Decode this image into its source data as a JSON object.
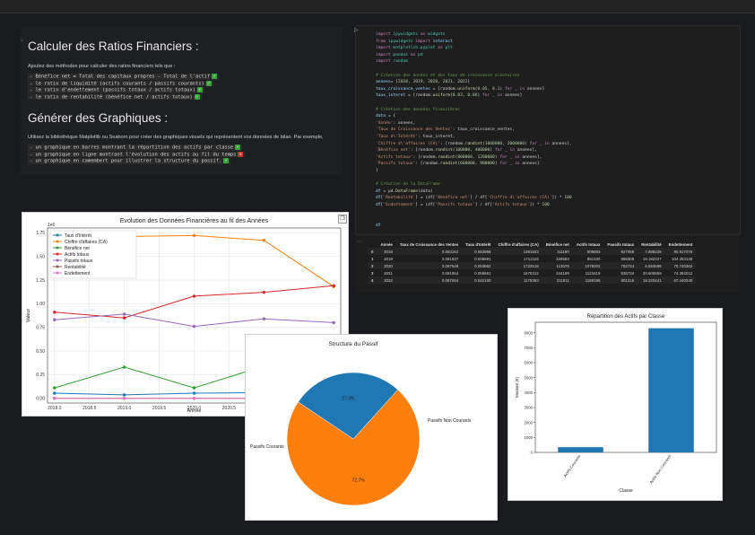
{
  "markdown": {
    "heading1": "Calculer des Ratios Financiers :",
    "intro1": "Ajoutez des méthodes pour calculer des ratios financiers tels que :",
    "ratios": [
      {
        "text": "- Bénéfice net = Total des capitaux propres - Total de l'actif",
        "status": "done"
      },
      {
        "text": "- le ratio de liquidité (actifs courants / passifs courants)",
        "status": "done"
      },
      {
        "text": "- le ratio d'endettement (passifs totaux / actifs totaux)",
        "status": "done"
      },
      {
        "text": "- le ratio de rentabilité (bénéfice net / actifs totaux)",
        "status": "done"
      }
    ],
    "heading2": "Générer des Graphiques :",
    "intro2": "Utilisez la bibliothèque Matplotlib ou Seaborn pour créer des graphiques visuels qui représentent vos données de bilan. Par exemple,",
    "graphs": [
      {
        "text": "- un graphique en barres montrant la répartition des actifs par classe",
        "status": "done"
      },
      {
        "text": "- un graphique en ligne montrant l'évolution des actifs au fil du temps",
        "status": "todo"
      },
      {
        "text": "- un graphique en camembert pour illustrer la structure du passif.",
        "status": "done"
      }
    ]
  },
  "code": {
    "lines": [
      [
        [
          "kw",
          "import "
        ],
        [
          "md",
          "ipywidgets"
        ],
        [
          "kw",
          " as "
        ],
        [
          "md",
          "widgets"
        ]
      ],
      [
        [
          "kw",
          "from "
        ],
        [
          "md",
          "ipywidgets"
        ],
        [
          "kw",
          " import "
        ],
        [
          "vr",
          "interact"
        ]
      ],
      [
        [
          "kw",
          "import "
        ],
        [
          "md",
          "matplotlib.pyplot"
        ],
        [
          "kw",
          " as "
        ],
        [
          "md",
          "plt"
        ]
      ],
      [
        [
          "kw",
          "import "
        ],
        [
          "md",
          "pandas"
        ],
        [
          "kw",
          " as "
        ],
        [
          "md",
          "pd"
        ]
      ],
      [
        [
          "kw",
          "import "
        ],
        [
          "md",
          "random"
        ]
      ],
      [],
      [
        [
          "cm",
          "# Création des années et des taux de croissance aléatoires"
        ]
      ],
      [
        [
          "vr",
          "annees"
        ],
        [
          "",
          "= ["
        ],
        [
          "nm",
          "2018, 2019, 2020, 2021, 2022"
        ],
        [
          "",
          "]"
        ]
      ],
      [
        [
          "vr",
          "taux_croissance_ventes"
        ],
        [
          "",
          " = [random."
        ],
        [
          "fn",
          "uniform"
        ],
        [
          "",
          "("
        ],
        [
          "nm",
          "0.05, 0.1"
        ],
        [
          "",
          ") "
        ],
        [
          "kw",
          "for"
        ],
        [
          "",
          " _ "
        ],
        [
          "kw",
          "in"
        ],
        [
          "",
          " annees]"
        ]
      ],
      [
        [
          "vr",
          "taux_interet"
        ],
        [
          "",
          " = [random."
        ],
        [
          "fn",
          "uniform"
        ],
        [
          "",
          "("
        ],
        [
          "nm",
          "0.03, 0.06"
        ],
        [
          "",
          ") "
        ],
        [
          "kw",
          "for"
        ],
        [
          "",
          " _ "
        ],
        [
          "kw",
          "in"
        ],
        [
          "",
          " annees]"
        ]
      ],
      [],
      [
        [
          "cm",
          "# Création des données financières"
        ]
      ],
      [
        [
          "vr",
          "data"
        ],
        [
          "",
          " = {"
        ]
      ],
      [
        [
          "",
          "    "
        ],
        [
          "st",
          "'Année'"
        ],
        [
          "",
          ": annees,"
        ]
      ],
      [
        [
          "",
          "    "
        ],
        [
          "st",
          "'Taux de Croissance des Ventes'"
        ],
        [
          "",
          ": taux_croissance_ventes,"
        ]
      ],
      [
        [
          "",
          "    "
        ],
        [
          "st",
          "'Taux d\\'Intérêt'"
        ],
        [
          "",
          ": taux_interet,"
        ]
      ],
      [
        [
          "",
          "    "
        ],
        [
          "st",
          "'Chiffre d\\'affaires (CA)'"
        ],
        [
          "",
          ": [random."
        ],
        [
          "fn",
          "randint"
        ],
        [
          "",
          "("
        ],
        [
          "nm",
          "1000000, 2000000"
        ],
        [
          "",
          ") "
        ],
        [
          "kw",
          "for"
        ],
        [
          "",
          " _ "
        ],
        [
          "kw",
          "in"
        ],
        [
          "",
          " annees],"
        ]
      ],
      [
        [
          "",
          "    "
        ],
        [
          "st",
          "'Bénéfice net'"
        ],
        [
          "",
          ": [random."
        ],
        [
          "fn",
          "randint"
        ],
        [
          "",
          "("
        ],
        [
          "nm",
          "100000, 400000"
        ],
        [
          "",
          ") "
        ],
        [
          "kw",
          "for"
        ],
        [
          "",
          " _ "
        ],
        [
          "kw",
          "in"
        ],
        [
          "",
          " annees],"
        ]
      ],
      [
        [
          "",
          "    "
        ],
        [
          "st",
          "'Actifs totaux'"
        ],
        [
          "",
          ": [random."
        ],
        [
          "fn",
          "randint"
        ],
        [
          "",
          "("
        ],
        [
          "nm",
          "800000, 1200000"
        ],
        [
          "",
          ") "
        ],
        [
          "kw",
          "for"
        ],
        [
          "",
          " _ "
        ],
        [
          "kw",
          "in"
        ],
        [
          "",
          " annees],"
        ]
      ],
      [
        [
          "",
          "    "
        ],
        [
          "st",
          "'Passifs totaux'"
        ],
        [
          "",
          ": [random."
        ],
        [
          "fn",
          "randint"
        ],
        [
          "",
          "("
        ],
        [
          "nm",
          "600000, 900000"
        ],
        [
          "",
          ") "
        ],
        [
          "kw",
          "for"
        ],
        [
          "",
          " _ "
        ],
        [
          "kw",
          "in"
        ],
        [
          "",
          " annees]"
        ]
      ],
      [
        [
          "",
          "}"
        ]
      ],
      [],
      [
        [
          "cm",
          "# Création de la DataFrame"
        ]
      ],
      [
        [
          "vr",
          "df"
        ],
        [
          "",
          " = pd."
        ],
        [
          "fn",
          "DataFrame"
        ],
        [
          "",
          "(data)"
        ]
      ],
      [
        [
          "vr",
          "df"
        ],
        [
          "",
          "["
        ],
        [
          "st",
          "'Rentabilité'"
        ],
        [
          "",
          "] = (df["
        ],
        [
          "st",
          "'Bénéfice net'"
        ],
        [
          "",
          "] / df["
        ],
        [
          "st",
          "'Chiffre d\\'affaires (CA)'"
        ],
        [
          "",
          "]) * "
        ],
        [
          "nm",
          "100"
        ]
      ],
      [
        [
          "vr",
          "df"
        ],
        [
          "",
          "["
        ],
        [
          "st",
          "'Endettement'"
        ],
        [
          "",
          "] = (df["
        ],
        [
          "st",
          "'Passifs totaux'"
        ],
        [
          "",
          "] / df["
        ],
        [
          "st",
          "'Actifs totaux'"
        ],
        [
          "",
          "]) * "
        ],
        [
          "nm",
          "100"
        ]
      ],
      [],
      [],
      [
        [
          "vr",
          "df"
        ]
      ]
    ]
  },
  "dataframe": {
    "columns": [
      "",
      "Année",
      "Taux de Croissance des Ventes",
      "Taux d'Intérêt",
      "Chiffre d'affaires (CA)",
      "Bénéfice net",
      "Actifs totaux",
      "Passifs totaux",
      "Rentabilité",
      "Endettement"
    ],
    "rows": [
      [
        "0",
        "2018",
        "0.063152",
        "0.053958",
        "1391923",
        "111190",
        "909683",
        "827059",
        "7.988229",
        "90.917276"
      ],
      [
        "1",
        "2019",
        "0.081937",
        "0.035691",
        "1712115",
        "328683",
        "851230",
        "888306",
        "19.182227",
        "104.353128"
      ],
      [
        "2",
        "2020",
        "0.067548",
        "0.053692",
        "1722519",
        "113576",
        "1078202",
        "762724",
        "6.593599",
        "70.740362"
      ],
      [
        "3",
        "2021",
        "0.091954",
        "0.059661",
        "1670312",
        "344199",
        "1123419",
        "835734",
        "20.606869",
        "74.392012"
      ],
      [
        "4",
        "2022",
        "0.087654",
        "0.042100",
        "1175363",
        "211811",
        "1188198",
        "801316",
        "18.220441",
        "67.440240"
      ]
    ]
  },
  "charts_text": {
    "line_title": "Evolution des Données Financières au fil des Années",
    "line_xlabel": "Année",
    "line_ylabel": "Valeur",
    "line_offset": "1e6",
    "pie_title": "Structure du Passif",
    "bar_title": "Répartition des Actifs par Classe",
    "bar_xlabel": "Classe",
    "bar_ylabel": "Montant (€)"
  },
  "chart_data": [
    {
      "type": "line",
      "title": "Evolution des Données Financières au fil des Années",
      "xlabel": "Année",
      "ylabel": "Valeur",
      "x": [
        2018,
        2019,
        2020,
        2021,
        2022
      ],
      "xticks": [
        "2018.0",
        "2018.5",
        "2019.0",
        "2019.5",
        "2020.0",
        "2020.5"
      ],
      "yticks": [
        "0.00",
        "0.25",
        "0.50",
        "0.75",
        "1.00",
        "1.25",
        "1.50",
        "1.75"
      ],
      "ylim": [
        -0.05,
        1.8
      ],
      "xlim": [
        2017.9,
        2022.1
      ],
      "legend": "upper-left",
      "series": [
        {
          "name": "Taux d'Intérêt",
          "color": "#1f77b4",
          "values": [
            0.054,
            0.036,
            0.054,
            0.06,
            0.042
          ]
        },
        {
          "name": "Chiffre d'affaires (CA)",
          "color": "#ff7f0e",
          "values": [
            1.39,
            1.71,
            1.72,
            1.67,
            1.18
          ]
        },
        {
          "name": "Bénéfice net",
          "color": "#2ca02c",
          "values": [
            0.11,
            0.33,
            0.11,
            0.34,
            0.21
          ]
        },
        {
          "name": "Actifs totaux",
          "color": "#d62728",
          "values": [
            0.91,
            0.85,
            1.08,
            1.12,
            1.19
          ]
        },
        {
          "name": "Passifs totaux",
          "color": "#9467bd",
          "values": [
            0.83,
            0.89,
            0.76,
            0.84,
            0.8
          ]
        },
        {
          "name": "Rentabilité",
          "color": "#8c564b",
          "values": [
            0.0,
            0.0,
            0.0,
            0.0,
            0.0
          ]
        },
        {
          "name": "Endettement",
          "color": "#e377c2",
          "values": [
            0.0,
            0.0,
            0.0,
            0.0,
            0.0
          ]
        }
      ]
    },
    {
      "type": "pie",
      "title": "Structure du Passif",
      "slices": [
        {
          "label": "Passifs Non Courants",
          "value": 72.7,
          "pct": "72.7%",
          "color": "#ff7f0e"
        },
        {
          "label": "Passifs Courants",
          "value": 27.3,
          "pct": "27.3%",
          "color": "#1f77b4"
        }
      ]
    },
    {
      "type": "bar",
      "title": "Répartition des Actifs par Classe",
      "xlabel": "Classe",
      "ylabel": "Montant (€)",
      "categories": [
        "Actifs Courants",
        "Actifs Non Courants"
      ],
      "values": [
        350,
        8300
      ],
      "color": "#1f77b4",
      "ylim": [
        0,
        8700
      ],
      "yticks": [
        "0",
        "1000",
        "2000",
        "3000",
        "4000",
        "5000",
        "6000",
        "7000",
        "8000"
      ]
    }
  ]
}
